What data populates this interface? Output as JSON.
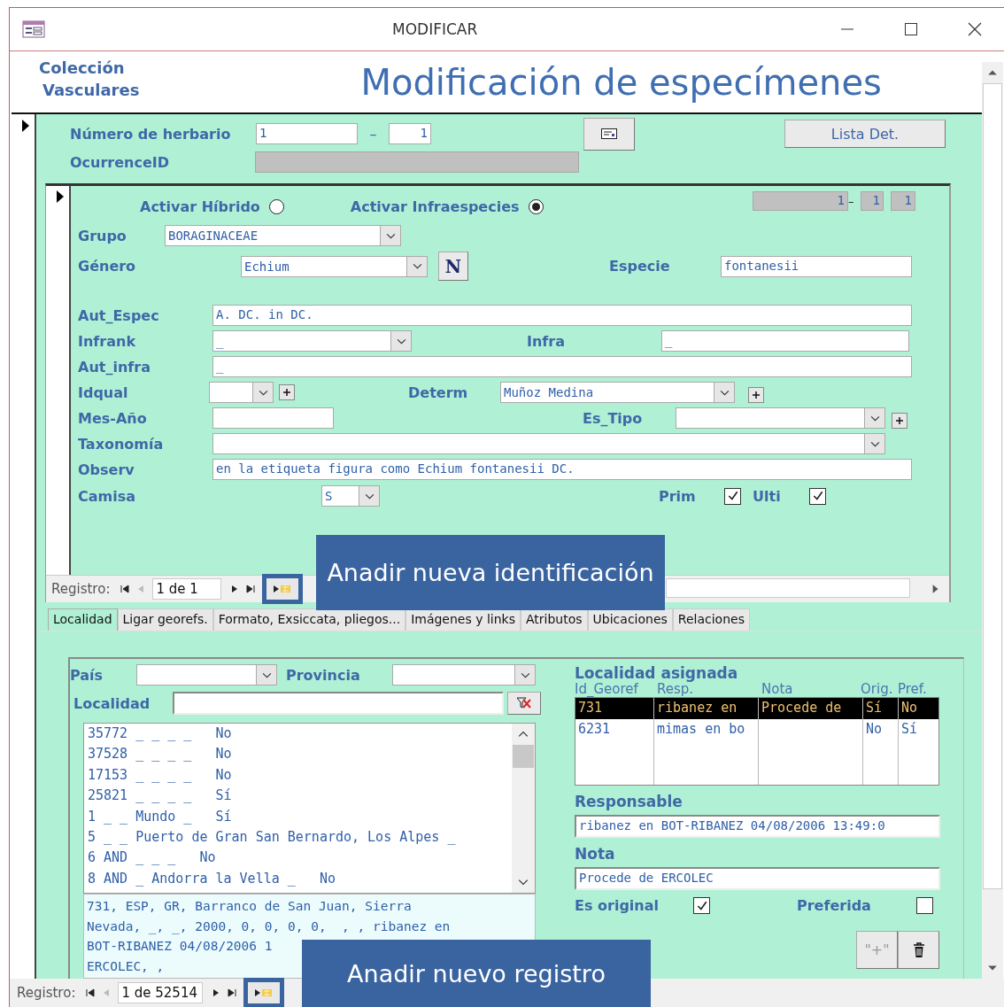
{
  "window": {
    "title": "MODIFICAR"
  },
  "header": {
    "collection_lines": [
      "Colección",
      "Vasculares"
    ],
    "title": "Modificación de especímenes"
  },
  "herbario": {
    "label": "Número de herbario",
    "number": "1",
    "separator": "–",
    "suffix": "1",
    "list_button": "Lista Det.",
    "occurrence_label": "OcurrenceID"
  },
  "identification": {
    "activar_hibrido": {
      "label": "Activar Híbrido",
      "selected": false
    },
    "activar_infraespecies": {
      "label": "Activar Infraespecies",
      "selected": true
    },
    "counters": {
      "first": "1",
      "separator": "–",
      "second": "1",
      "third": "1"
    },
    "grupo": {
      "label": "Grupo",
      "value": "BORAGINACEAE"
    },
    "genero": {
      "label": "Género",
      "value": "Echium",
      "button": "N"
    },
    "especie": {
      "label": "Especie",
      "value": "fontanesii"
    },
    "aut_espec": {
      "label": "Aut_Espec",
      "value": "A. DC. in DC."
    },
    "infrank": {
      "label": "Infrank",
      "value": "_"
    },
    "infra": {
      "label": "Infra",
      "value": "_"
    },
    "aut_infra": {
      "label": "Aut_infra",
      "value": "_"
    },
    "idqual": {
      "label": "Idqual"
    },
    "determ": {
      "label": "Determ",
      "value": "Muñoz Medina"
    },
    "mes_ano": {
      "label": "Mes-Año"
    },
    "es_tipo": {
      "label": "Es_Tipo"
    },
    "taxonomia": {
      "label": "Taxonomía"
    },
    "observ": {
      "label": "Observ",
      "value": "en la etiqueta figura como Echium fontanesii DC."
    },
    "camisa": {
      "label": "Camisa",
      "value": "S"
    },
    "prim": {
      "label": "Prim",
      "checked": true
    },
    "ulti": {
      "label": "Ulti",
      "checked": true
    }
  },
  "subform_nav": {
    "label": "Registro:",
    "position": "1 de 1",
    "callout": "Anadir nueva identificación"
  },
  "tabs": [
    {
      "label": "Localidad",
      "selected": true
    },
    {
      "label": "Ligar georefs.",
      "selected": false
    },
    {
      "label": "Formato, Exsiccata, pliegos...",
      "selected": false
    },
    {
      "label": "Imágenes y links",
      "selected": false
    },
    {
      "label": "Atributos",
      "selected": false
    },
    {
      "label": "Ubicaciones",
      "selected": false
    },
    {
      "label": "Relaciones",
      "selected": false
    }
  ],
  "localidad": {
    "pais": {
      "label": "País"
    },
    "provincia": {
      "label": "Provincia"
    },
    "localidad": {
      "label": "Localidad"
    },
    "list_rows": [
      "35772 _ _ _ _   No",
      "37528 _ _ _ _   No",
      "17153 _ _ _ _   No",
      "25821 _ _ _ _   Sí",
      "1 _ _ Mundo _   Sí",
      "5 _ _ Puerto de Gran San Bernardo, Los Alpes _",
      "6 AND _ _ _   No",
      "8 AND _ Andorra la Vella _   No"
    ],
    "summary_lines": [
      "731, ESP, GR, Barranco de San Juan, Sierra",
      "Nevada, _, _, 2000, 0, 0, 0, 0,  , , ribanez en",
      "BOT-RIBANEZ 04/08/2006 1",
      "ERCOLEC, ,"
    ]
  },
  "asignada": {
    "title": "Localidad asignada",
    "columns": [
      "Id_Georef",
      "Resp.",
      "Nota",
      "Orig.",
      "Pref."
    ],
    "rows": [
      {
        "id": "731",
        "resp": "ribanez en",
        "nota": "Procede de",
        "orig": "Sí",
        "pref": "No",
        "selected": true
      },
      {
        "id": "6231",
        "resp": "mimas en bo",
        "orig": "No",
        "pref": "Sí",
        "selected": false
      }
    ],
    "responsable": {
      "label": "Responsable",
      "value": "ribanez en BOT-RIBANEZ 04/08/2006 13:49:0"
    },
    "nota": {
      "label": "Nota",
      "value": "Procede de ERCOLEC"
    },
    "es_original": {
      "label": "Es original",
      "checked": true
    },
    "preferida": {
      "label": "Preferida",
      "checked": false
    },
    "add_button": "\"+\""
  },
  "main_nav": {
    "label": "Registro:",
    "position": "1 de 52514",
    "callout": "Anadir nuevo registro"
  }
}
